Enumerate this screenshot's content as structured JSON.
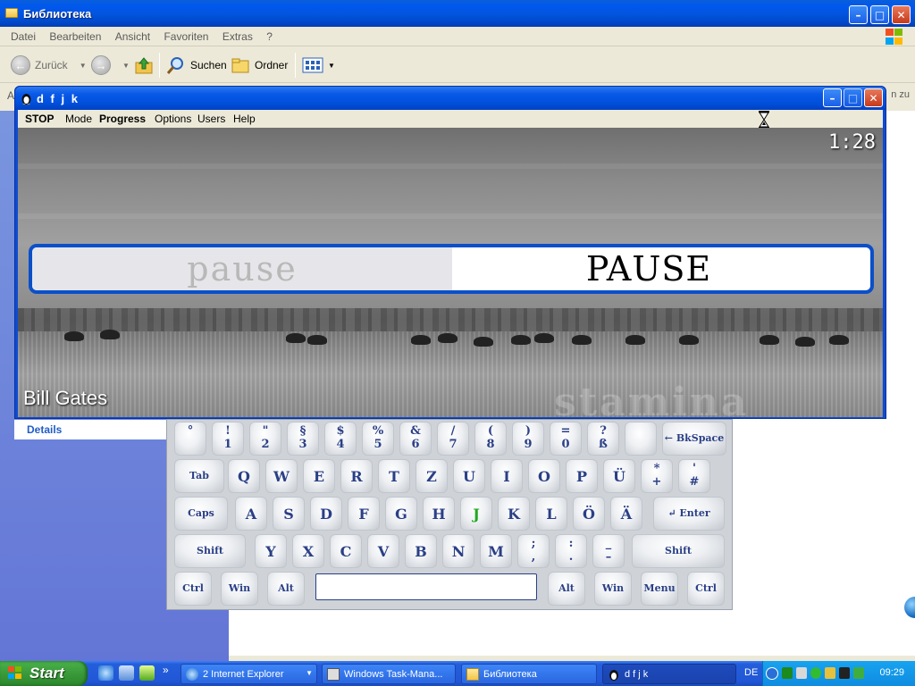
{
  "explorer": {
    "title": "Библиотека",
    "menu": [
      "Datei",
      "Bearbeiten",
      "Ansicht",
      "Favoriten",
      "Extras",
      "?"
    ],
    "toolbar": {
      "back": "Zurück",
      "search": "Suchen",
      "folders": "Ordner"
    },
    "address_prefix": "A",
    "address_suffix": "n zu",
    "details": "Details"
  },
  "app": {
    "title": "d f j k",
    "menu": {
      "stop": "STOP",
      "mode": "Mode",
      "progress": "Progress",
      "options": "Options",
      "users": "Users",
      "help": "Help"
    },
    "timer": "1:28",
    "typed_text": "pause",
    "target_text": "PAUSE",
    "author": "Bill Gates",
    "watermark": "stamina"
  },
  "keyboard": {
    "row1": [
      {
        "top": "°",
        "bot": ""
      },
      {
        "top": "!",
        "bot": "1"
      },
      {
        "top": "\"",
        "bot": "2"
      },
      {
        "top": "§",
        "bot": "3"
      },
      {
        "top": "$",
        "bot": "4"
      },
      {
        "top": "%",
        "bot": "5"
      },
      {
        "top": "&",
        "bot": "6"
      },
      {
        "top": "/",
        "bot": "7"
      },
      {
        "top": "(",
        "bot": "8"
      },
      {
        "top": ")",
        "bot": "9"
      },
      {
        "top": "=",
        "bot": "0"
      },
      {
        "top": "?",
        "bot": "ß"
      },
      {
        "top": "",
        "bot": ""
      }
    ],
    "backspace": "← BkSpace",
    "tab": "Tab",
    "row2": [
      "Q",
      "W",
      "E",
      "R",
      "T",
      "Z",
      "U",
      "I",
      "O",
      "P",
      "Ü"
    ],
    "row2_extra": [
      {
        "top": "*",
        "bot": "+"
      },
      {
        "top": "'",
        "bot": "#"
      }
    ],
    "caps": "Caps",
    "row3": [
      "A",
      "S",
      "D",
      "F",
      "G",
      "H",
      "J",
      "K",
      "L",
      "Ö",
      "Ä"
    ],
    "highlighted_key": "J",
    "enter": "↵ Enter",
    "shift": "Shift",
    "row4": [
      "Y",
      "X",
      "C",
      "V",
      "B",
      "N",
      "M"
    ],
    "row4_extra": [
      {
        "top": ";",
        "bot": ","
      },
      {
        "top": ":",
        "bot": "."
      },
      {
        "top": "_",
        "bot": "–"
      }
    ],
    "row5_left": [
      "Ctrl",
      "Win",
      "Alt"
    ],
    "row5_right": [
      "Alt",
      "Win",
      "Menu",
      "Ctrl"
    ]
  },
  "taskbar": {
    "start": "Start",
    "more": "»",
    "tasks": [
      "2 Internet Explorer",
      "Windows Task-Mana...",
      "Библиотека",
      "d f j k"
    ],
    "lang": "DE",
    "clock": "09:29"
  },
  "colors": {
    "xp_blue": "#0058ee",
    "key_text": "#2a3f86",
    "home_key": "#1fa91f",
    "start_green": "#3a9a3a"
  }
}
